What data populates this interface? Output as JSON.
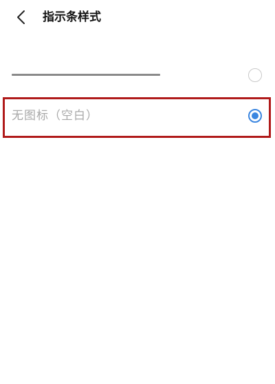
{
  "header": {
    "back_icon": "chevron-left-icon",
    "title": "指示条样式"
  },
  "options": [
    {
      "kind": "line-indicator",
      "label": "",
      "selected": false
    },
    {
      "kind": "text",
      "label": "无图标（空白）",
      "selected": true
    }
  ],
  "colors": {
    "accent": "#3a86e0",
    "highlight": "#b01a1a",
    "label_text": "#a8a8a8"
  }
}
